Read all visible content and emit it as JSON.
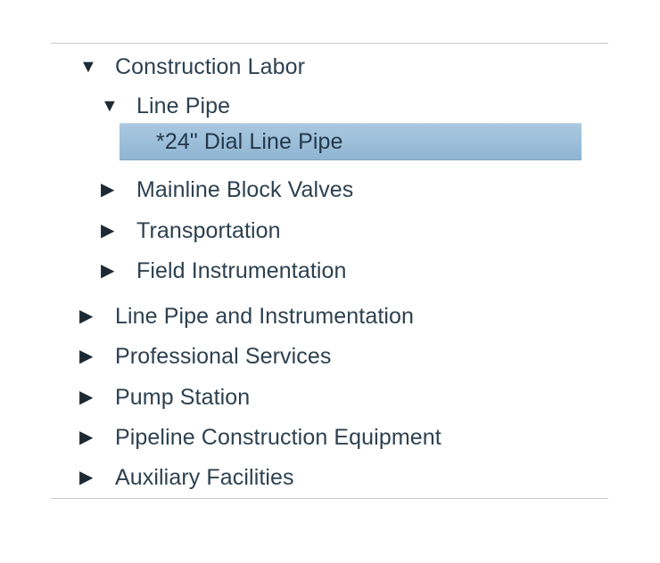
{
  "tree": {
    "construction_labor": {
      "toggle": "▼",
      "label": "Construction Labor"
    },
    "line_pipe": {
      "toggle": "▼",
      "label": "Line Pipe"
    },
    "dial_line_pipe": {
      "label": "*24\" Dial Line Pipe",
      "selected": true
    },
    "mainline_block_valves": {
      "toggle": "▶",
      "label": "Mainline Block Valves"
    },
    "transportation": {
      "toggle": "▶",
      "label": "Transportation"
    },
    "field_instrumentation": {
      "toggle": "▶",
      "label": "Field Instrumentation"
    },
    "line_pipe_and_instrumentation": {
      "toggle": "▶",
      "label": "Line Pipe and Instrumentation"
    },
    "professional_services": {
      "toggle": "▶",
      "label": "Professional Services"
    },
    "pump_station": {
      "toggle": "▶",
      "label": "Pump Station"
    },
    "pipeline_construction_equipment": {
      "toggle": "▶",
      "label": "Pipeline Construction Equipment"
    },
    "auxiliary_facilities": {
      "toggle": "▶",
      "label": "Auxiliary Facilities"
    }
  },
  "colors": {
    "text": "#2d4150",
    "selection": "#9dbfda",
    "divider": "#c8c8c8"
  }
}
